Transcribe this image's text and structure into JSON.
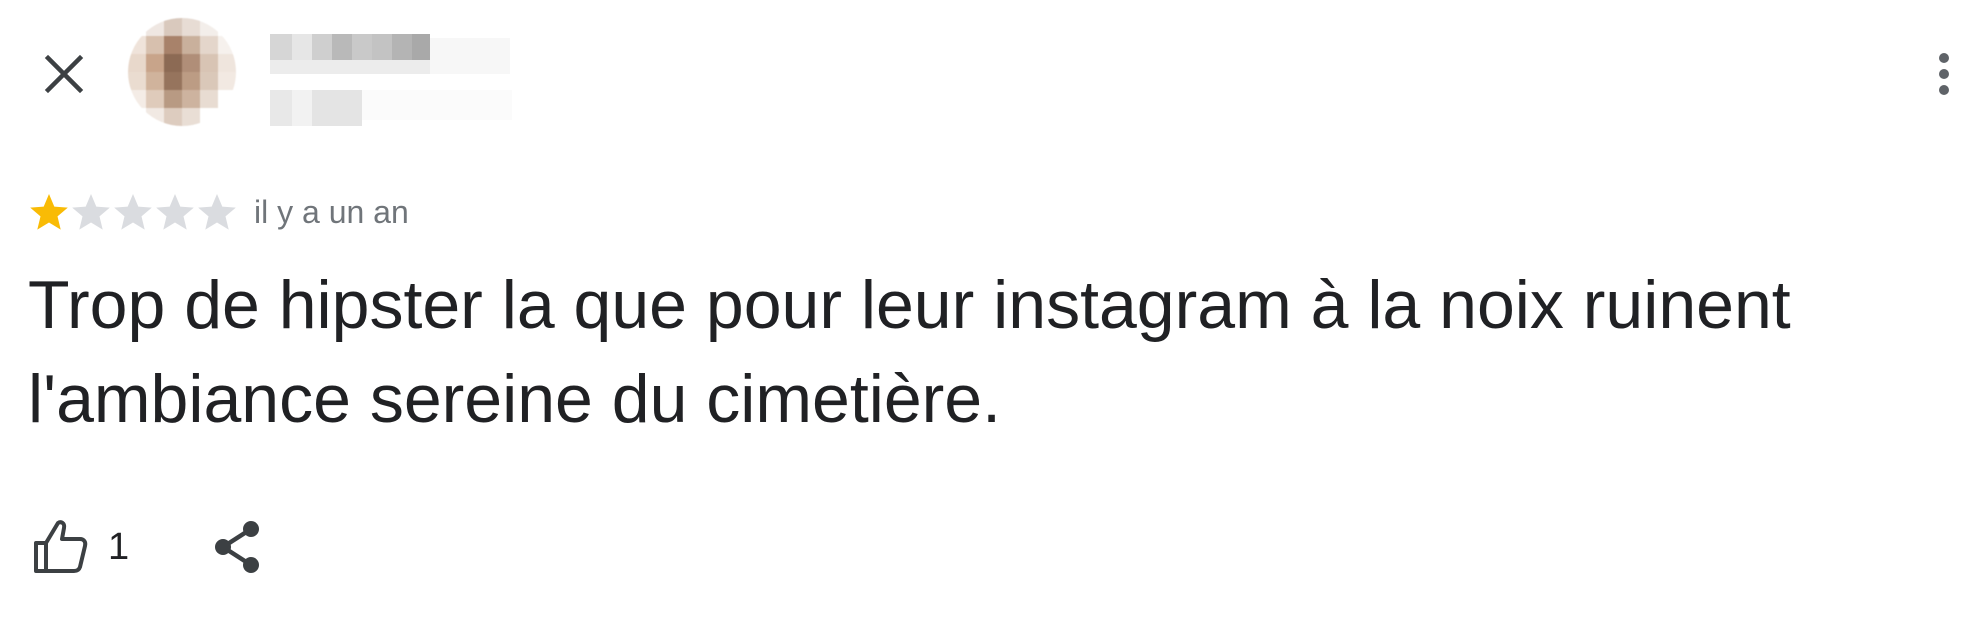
{
  "header": {
    "close_icon": "close-icon",
    "more_icon": "more-vert-icon"
  },
  "review": {
    "rating": 1,
    "max_rating": 5,
    "star_color": "#f9bb05",
    "empty_star_color": "#dadce0",
    "time_ago": "il y a un an",
    "text": "Trop de hipster la que pour leur instagram à la noix ruinent l'ambiance sereine du cimetière."
  },
  "actions": {
    "like_icon": "thumb-up-icon",
    "like_count": "1",
    "share_icon": "share-icon"
  }
}
